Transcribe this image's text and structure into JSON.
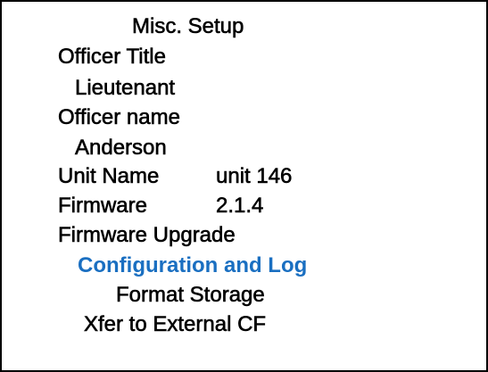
{
  "title": "Misc. Setup",
  "menu": {
    "officer_title_label": "Officer Title",
    "officer_title_value": "Lieutenant",
    "officer_name_label": "Officer name",
    "officer_name_value": "Anderson",
    "unit_name_label": "Unit Name",
    "unit_name_value": "unit 146",
    "firmware_label": "Firmware",
    "firmware_value": "2.1.4",
    "firmware_upgrade_label": "Firmware Upgrade",
    "config_log_label": "Configuration and Log",
    "format_storage_label": "Format Storage",
    "xfer_label": "Xfer to External CF"
  },
  "colors": {
    "highlight": "#1a6fc1",
    "text": "#000000",
    "background": "#ffffff"
  }
}
